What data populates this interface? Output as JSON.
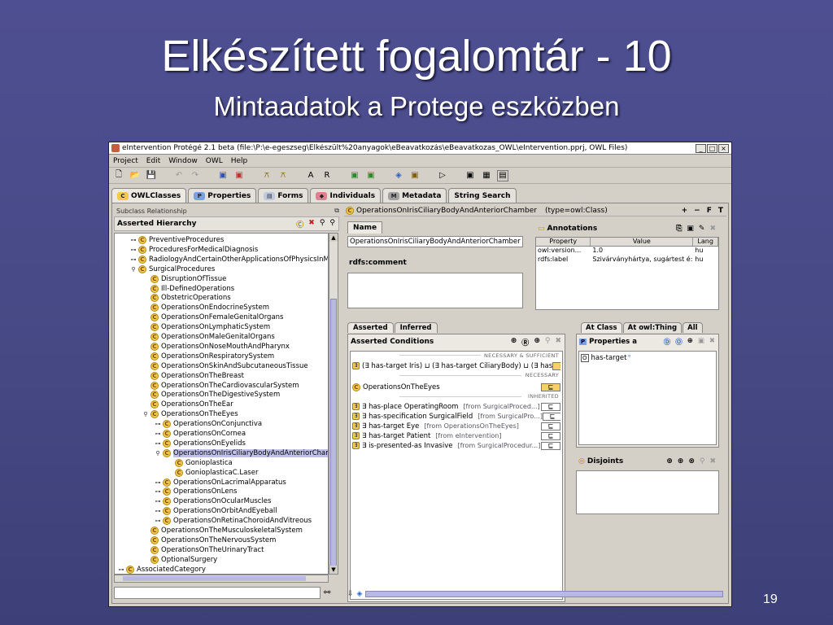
{
  "slide": {
    "title": "Elkészített fogalomtár - 10",
    "subtitle": "Mintaadatok a Protege eszközben",
    "page_number": "19"
  },
  "window": {
    "title": "eIntervention  Protégé 2.1 beta    (file:\\P:\\e-egeszseg\\Elkészült%20anyagok\\eBeavatkozás\\eBeavatkozas_OWL\\eIntervention.pprj, OWL Files)",
    "controls": [
      "_",
      "□",
      "×"
    ]
  },
  "menu": [
    "Project",
    "Edit",
    "Window",
    "OWL",
    "Help"
  ],
  "toolbar_text": [
    "A",
    "R"
  ],
  "tabs": [
    {
      "label": "OWLClasses",
      "icon": "C",
      "color": "#f2c94c"
    },
    {
      "label": "Properties",
      "icon": "P",
      "color": "#7aa0e0"
    },
    {
      "label": "Forms",
      "icon": "▤",
      "color": "#c0c8e0"
    },
    {
      "label": "Individuals",
      "icon": "◆",
      "color": "#e08090"
    },
    {
      "label": "Metadata",
      "icon": "M",
      "color": "#a0a0a0"
    },
    {
      "label": "String Search",
      "icon": "",
      "color": "#d4d0c8"
    }
  ],
  "left_panel": {
    "subclass_relationship": "Subclass Relationship",
    "header": "Asserted Hierarchy"
  },
  "tree": [
    {
      "label": "PreventiveProcedures",
      "indent": 1,
      "exp": "⊶"
    },
    {
      "label": "ProceduresForMedicalDiagnosis",
      "indent": 1,
      "exp": "⊶"
    },
    {
      "label": "RadiologyAndCertainOtherApplicationsOfPhysicsInMe",
      "indent": 1,
      "exp": "⊶"
    },
    {
      "label": "SurgicalProcedures",
      "indent": 1,
      "exp": "⚲"
    },
    {
      "label": "DisruptionOfTissue",
      "indent": 2,
      "exp": ""
    },
    {
      "label": "Ill-DefinedOperations",
      "indent": 2,
      "exp": ""
    },
    {
      "label": "ObstetricOperations",
      "indent": 2,
      "exp": ""
    },
    {
      "label": "OperationsOnEndocrineSystem",
      "indent": 2,
      "exp": ""
    },
    {
      "label": "OperationsOnFemaleGenitalOrgans",
      "indent": 2,
      "exp": ""
    },
    {
      "label": "OperationsOnLymphaticSystem",
      "indent": 2,
      "exp": ""
    },
    {
      "label": "OperationsOnMaleGenitalOrgans",
      "indent": 2,
      "exp": ""
    },
    {
      "label": "OperationsOnNoseMouthAndPharynx",
      "indent": 2,
      "exp": ""
    },
    {
      "label": "OperationsOnRespiratorySystem",
      "indent": 2,
      "exp": ""
    },
    {
      "label": "OperationsOnSkinAndSubcutaneousTissue",
      "indent": 2,
      "exp": ""
    },
    {
      "label": "OperationsOnTheBreast",
      "indent": 2,
      "exp": ""
    },
    {
      "label": "OperationsOnTheCardiovascularSystem",
      "indent": 2,
      "exp": ""
    },
    {
      "label": "OperationsOnTheDigestiveSystem",
      "indent": 2,
      "exp": ""
    },
    {
      "label": "OperationsOnTheEar",
      "indent": 2,
      "exp": ""
    },
    {
      "label": "OperationsOnTheEyes",
      "indent": 2,
      "exp": "⚲"
    },
    {
      "label": "OperationsOnConjunctiva",
      "indent": 3,
      "exp": "⊶"
    },
    {
      "label": "OperationsOnCornea",
      "indent": 3,
      "exp": "⊶"
    },
    {
      "label": "OperationsOnEyelids",
      "indent": 3,
      "exp": "⊶"
    },
    {
      "label": "OperationsOnIrisCiliaryBodyAndAnteriorCham",
      "indent": 3,
      "exp": "⚲",
      "selected": true
    },
    {
      "label": "Gonioplastica",
      "indent": 4,
      "exp": ""
    },
    {
      "label": "GonioplasticaC.Laser",
      "indent": 4,
      "exp": ""
    },
    {
      "label": "OperationsOnLacrimalApparatus",
      "indent": 3,
      "exp": "⊶"
    },
    {
      "label": "OperationsOnLens",
      "indent": 3,
      "exp": "⊶"
    },
    {
      "label": "OperationsOnOcularMuscles",
      "indent": 3,
      "exp": "⊶"
    },
    {
      "label": "OperationsOnOrbitAndEyeball",
      "indent": 3,
      "exp": "⊶"
    },
    {
      "label": "OperationsOnRetinaChoroidAndVitreous",
      "indent": 3,
      "exp": "⊶"
    },
    {
      "label": "OperationsOnTheMusculoskeletalSystem",
      "indent": 2,
      "exp": ""
    },
    {
      "label": "OperationsOnTheNervousSystem",
      "indent": 2,
      "exp": ""
    },
    {
      "label": "OperationsOnTheUrinaryTract",
      "indent": 2,
      "exp": ""
    },
    {
      "label": "OptionalSurgery",
      "indent": 2,
      "exp": ""
    },
    {
      "label": "AssociatedCategory",
      "indent": 0,
      "exp": "⊶"
    }
  ],
  "class_bar": {
    "name": "OperationsOnIrisCiliaryBodyAndAnteriorChamber",
    "type": "(type=owl:Class)",
    "controls": [
      "+",
      "−",
      "F",
      "T"
    ]
  },
  "name_section": {
    "tab": "Name",
    "value": "OperationsOnIrisCiliaryBodyAndAnteriorChamber",
    "comment_label": "rdfs:comment"
  },
  "annotations": {
    "header": "Annotations",
    "columns": [
      "Property",
      "Value",
      "Lang"
    ],
    "rows": [
      {
        "prop": "owl:version...",
        "value": "1.0",
        "lang": "hu"
      },
      {
        "prop": "rdfs:label",
        "value": "Szivárványhártya, sugártest é:...",
        "lang": "hu"
      }
    ]
  },
  "conditions": {
    "tabs": [
      "Asserted",
      "Inferred"
    ],
    "header": "Asserted Conditions",
    "sections": {
      "necessary_sufficient": "NECESSARY & SUFFICIENT",
      "necessary": "NECESSARY",
      "inherited": "INHERITED"
    },
    "ns_row": {
      "text": "(∃ has-target Iris) ⊔ (∃ has-target CiliaryBody) ⊔ (∃ has",
      "mark": "≡"
    },
    "n_row": {
      "text": "OperationsOnTheEyes",
      "mark": "⊑"
    },
    "inherited_rows": [
      {
        "text": "∃ has-place OperatingRoom",
        "from": "[from SurgicalProced...]",
        "mark": "⊑"
      },
      {
        "text": "∃ has-specification SurgicalField",
        "from": "[from SurgicalPro...]",
        "mark": "⊑"
      },
      {
        "text": "∃ has-target Eye",
        "from": "[from OperationsOnTheEyes]",
        "mark": "⊑"
      },
      {
        "text": "∃ has-target Patient",
        "from": "[from eIntervention]",
        "mark": "⊑"
      },
      {
        "text": "∃ is-presented-as Invasive",
        "from": "[from SurgicalProcedur...]",
        "mark": "⊑"
      }
    ]
  },
  "at_class": {
    "tabs": [
      "At Class",
      "At owl:Thing",
      "All"
    ],
    "header": "Properties a",
    "items": [
      "has-target"
    ]
  },
  "disjoints": {
    "header": "Disjoints"
  }
}
